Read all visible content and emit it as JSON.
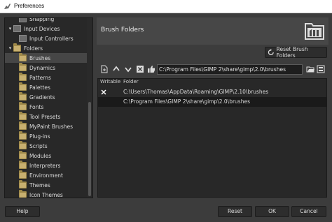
{
  "window": {
    "title": "Preferences"
  },
  "tree": {
    "items": [
      {
        "label": "Snapping",
        "indent": 1,
        "icon": "snapping-icon",
        "expander": ""
      },
      {
        "label": "Input Devices",
        "indent": 0,
        "icon": "input-devices-icon",
        "expander": "▾"
      },
      {
        "label": "Input Controllers",
        "indent": 1,
        "icon": "input-controllers-icon",
        "expander": ""
      },
      {
        "label": "Folders",
        "indent": 0,
        "icon": "folder-icon",
        "expander": "▾"
      },
      {
        "label": "Brushes",
        "indent": 1,
        "icon": "folder-icon",
        "expander": "",
        "selected": true
      },
      {
        "label": "Dynamics",
        "indent": 1,
        "icon": "folder-icon",
        "expander": ""
      },
      {
        "label": "Patterns",
        "indent": 1,
        "icon": "folder-icon",
        "expander": ""
      },
      {
        "label": "Palettes",
        "indent": 1,
        "icon": "folder-icon",
        "expander": ""
      },
      {
        "label": "Gradients",
        "indent": 1,
        "icon": "folder-icon",
        "expander": ""
      },
      {
        "label": "Fonts",
        "indent": 1,
        "icon": "folder-icon",
        "expander": ""
      },
      {
        "label": "Tool Presets",
        "indent": 1,
        "icon": "folder-icon",
        "expander": ""
      },
      {
        "label": "MyPaint Brushes",
        "indent": 1,
        "icon": "folder-icon",
        "expander": ""
      },
      {
        "label": "Plug-ins",
        "indent": 1,
        "icon": "folder-icon",
        "expander": ""
      },
      {
        "label": "Scripts",
        "indent": 1,
        "icon": "folder-icon",
        "expander": ""
      },
      {
        "label": "Modules",
        "indent": 1,
        "icon": "folder-icon",
        "expander": ""
      },
      {
        "label": "Interpreters",
        "indent": 1,
        "icon": "folder-icon",
        "expander": ""
      },
      {
        "label": "Environment",
        "indent": 1,
        "icon": "folder-icon",
        "expander": ""
      },
      {
        "label": "Themes",
        "indent": 1,
        "icon": "folder-icon",
        "expander": ""
      },
      {
        "label": "Icon Themes",
        "indent": 1,
        "icon": "folder-icon",
        "expander": ""
      }
    ]
  },
  "panel": {
    "title": "Brush Folders",
    "reset_label": "Reset Brush Folders",
    "path_value": "C:\\Program Files\\GIMP 2\\share\\gimp\\2.0\\brushes",
    "columns": {
      "writable": "Writable",
      "folder": "Folder"
    },
    "rows": [
      {
        "writable": true,
        "folder": "C:\\Users\\Thomas\\AppData\\Roaming\\GIMP\\2.10\\brushes",
        "selected": false
      },
      {
        "writable": false,
        "folder": "C:\\Program Files\\GIMP 2\\share\\gimp\\2.0\\brushes",
        "selected": true
      }
    ]
  },
  "footer": {
    "help": "Help",
    "reset": "Reset",
    "ok": "OK",
    "cancel": "Cancel"
  },
  "colors": {
    "background": "#3c3c3c",
    "panel": "#282828",
    "selection": "#464646"
  }
}
